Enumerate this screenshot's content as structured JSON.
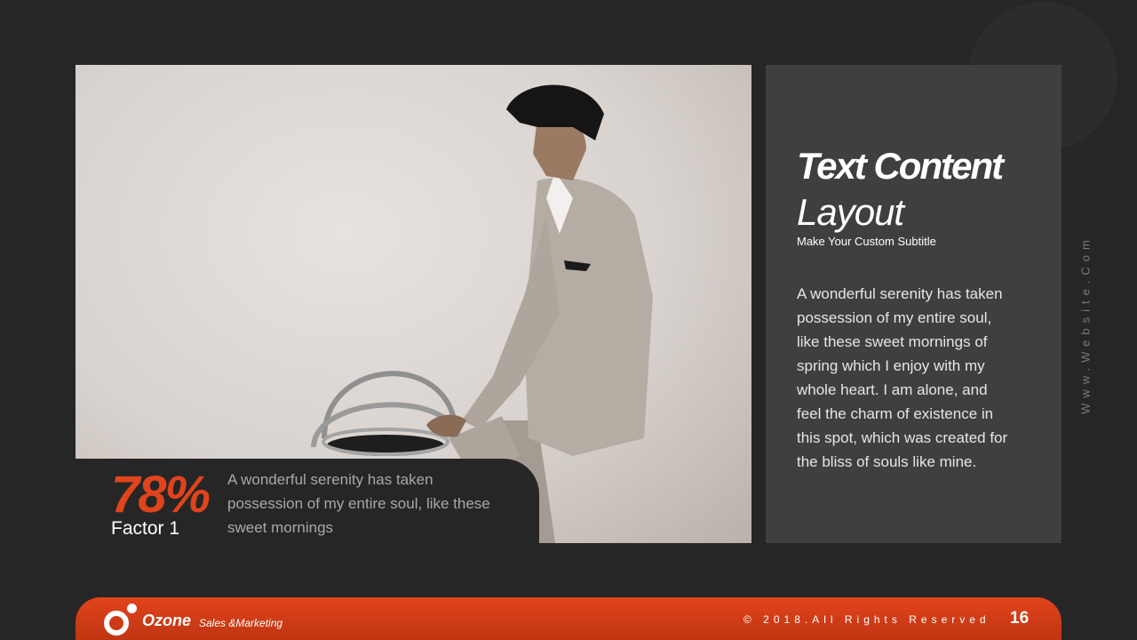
{
  "hero": {
    "title_line1": "Text Content",
    "title_line2": "Layout",
    "subtitle": "Make Your Custom Subtitle",
    "body": "A wonderful serenity has taken possession of my entire soul, like these sweet mornings of spring which I enjoy with my whole heart. I am alone, and feel the charm of existence in this spot, which was created for the bliss of souls like mine."
  },
  "stat": {
    "value": "78%",
    "label": "Factor 1",
    "description": "A wonderful serenity has taken possession of my entire soul, like these sweet mornings"
  },
  "side": {
    "website": "Www.Website.Com"
  },
  "footer": {
    "brand": "Ozone",
    "tagline": "Sales &Marketing",
    "copyright": "© 2018.All Rights Reserved",
    "page_number": "16"
  },
  "colors": {
    "background": "#262626",
    "accent": "#e0441c",
    "panel": "#3f3f3f"
  }
}
